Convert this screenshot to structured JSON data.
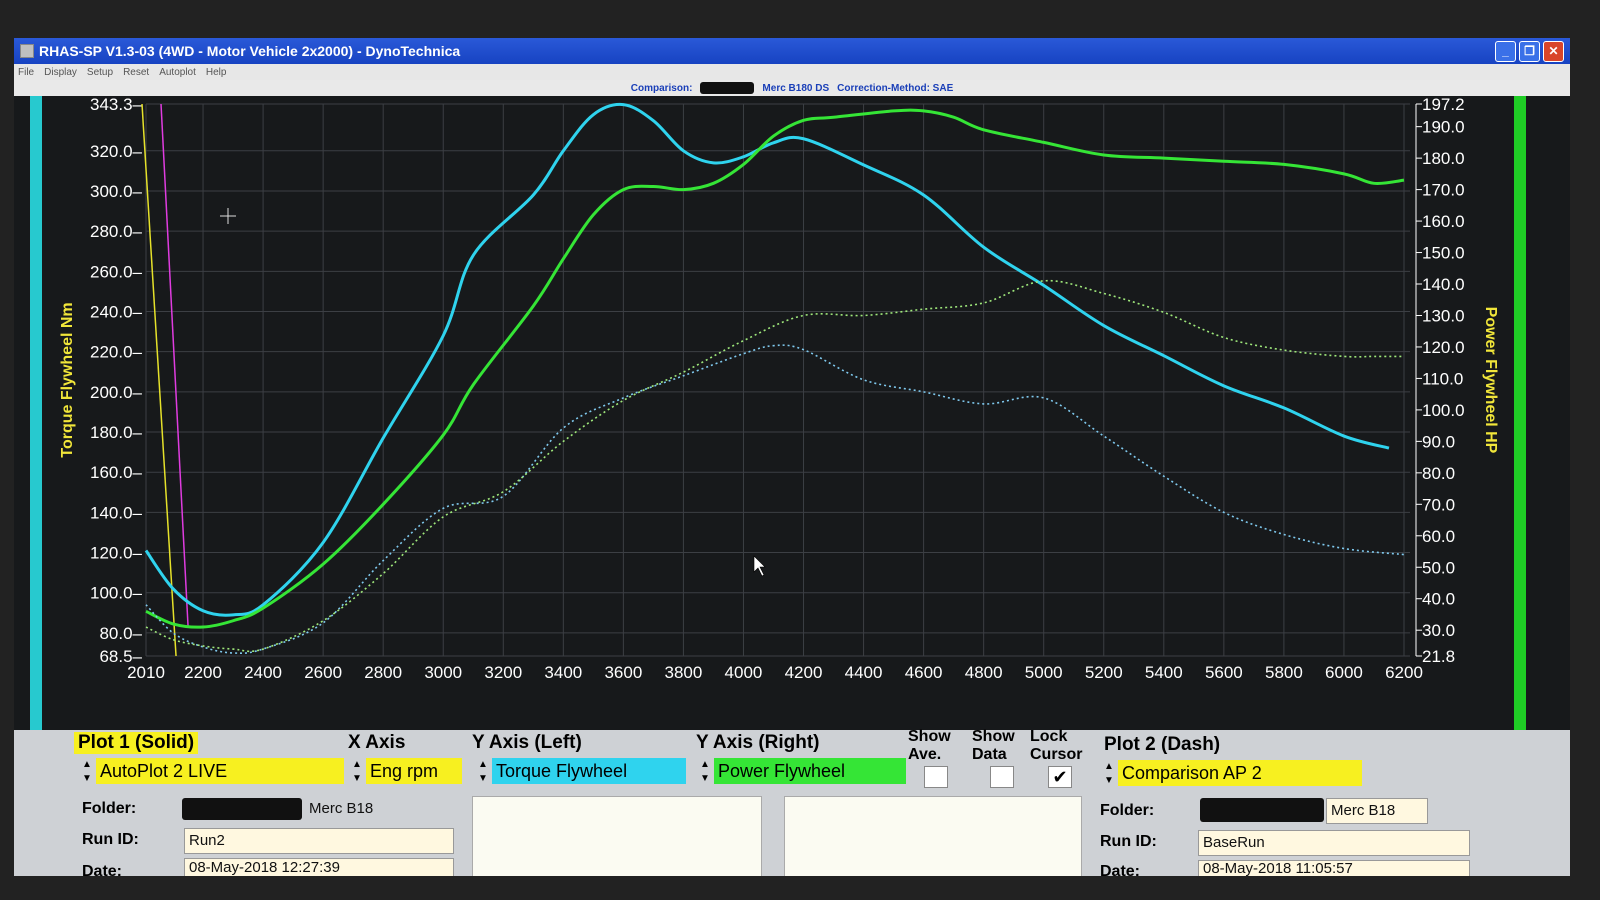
{
  "window": {
    "title": "RHAS-SP V1.3-03  (4WD - Motor Vehicle 2x2000) - DynoTechnica",
    "buttons": {
      "minimize": "_",
      "maximize": "❐",
      "close": "✕"
    }
  },
  "menu": [
    "File",
    "Display",
    "Setup",
    "Reset",
    "Autoplot",
    "Help"
  ],
  "comparison_bar": {
    "label": "Comparison:",
    "name": "Merc B180 DS",
    "correction": "Correction-Method: SAE"
  },
  "axes": {
    "left_title": "Torque Flywheel Nm",
    "right_title": "Power Flywheel HP",
    "left_ticks": [
      "343.3",
      "320.0",
      "300.0",
      "280.0",
      "260.0",
      "240.0",
      "220.0",
      "200.0",
      "180.0",
      "160.0",
      "140.0",
      "120.0",
      "100.0",
      "80.0",
      "68.5"
    ],
    "right_ticks": [
      "197.2",
      "190.0",
      "180.0",
      "170.0",
      "160.0",
      "150.0",
      "140.0",
      "130.0",
      "120.0",
      "110.0",
      "100.0",
      "90.0",
      "80.0",
      "70.0",
      "60.0",
      "50.0",
      "40.0",
      "30.0",
      "21.8"
    ],
    "x_ticks": [
      "2010",
      "2200",
      "2400",
      "2600",
      "2800",
      "3000",
      "3200",
      "3400",
      "3600",
      "3800",
      "4000",
      "4200",
      "4400",
      "4600",
      "4800",
      "5000",
      "5200",
      "5400",
      "5600",
      "5800",
      "6000",
      "6200"
    ]
  },
  "chart_data": {
    "type": "line",
    "x_range": [
      2010,
      6220
    ],
    "y_left_range": [
      68.5,
      343.3
    ],
    "y_right_range": [
      21.8,
      197.2
    ],
    "grid": true,
    "series": [
      {
        "name": "Torque Flywheel",
        "axis": "left",
        "style": "solid",
        "color": "#2fd3ee",
        "x": [
          2010,
          2100,
          2200,
          2300,
          2400,
          2600,
          2800,
          3000,
          3100,
          3300,
          3400,
          3500,
          3600,
          3700,
          3800,
          3900,
          4000,
          4100,
          4200,
          4400,
          4600,
          4800,
          5000,
          5200,
          5400,
          5600,
          5800,
          6000,
          6150
        ],
        "y": [
          121,
          102,
          91,
          89,
          94,
          125,
          177,
          228,
          268,
          298,
          320,
          338,
          343,
          335,
          320,
          314,
          317,
          324,
          326,
          313,
          298,
          272,
          253,
          233,
          218,
          203,
          192,
          178,
          172
        ]
      },
      {
        "name": "Power Flywheel",
        "axis": "right",
        "style": "solid",
        "color": "#35e536",
        "x": [
          2010,
          2100,
          2200,
          2300,
          2400,
          2600,
          2800,
          3000,
          3100,
          3300,
          3400,
          3500,
          3600,
          3700,
          3800,
          3900,
          4000,
          4100,
          4200,
          4300,
          4500,
          4600,
          4700,
          4800,
          5000,
          5200,
          5400,
          5600,
          5800,
          6000,
          6100,
          6200
        ],
        "y": [
          36,
          32,
          31,
          33,
          37,
          51,
          70,
          92,
          108,
          133,
          148,
          162,
          170,
          171,
          170,
          172,
          178,
          187,
          192,
          193,
          195,
          195,
          193,
          189,
          185,
          181,
          180,
          179,
          178,
          175,
          172,
          173
        ]
      },
      {
        "name": "Torque Flywheel (Comparison)",
        "axis": "left",
        "style": "dashed",
        "color": "#7fc9ee",
        "x": [
          2010,
          2100,
          2200,
          2300,
          2400,
          2600,
          2800,
          3000,
          3200,
          3400,
          3600,
          3800,
          4000,
          4100,
          4200,
          4400,
          4600,
          4800,
          5000,
          5200,
          5400,
          5600,
          5800,
          6000,
          6200
        ],
        "y": [
          94,
          80,
          73,
          70,
          72,
          85,
          116,
          142,
          148,
          182,
          197,
          208,
          219,
          223,
          221,
          206,
          200,
          194,
          197,
          178,
          158,
          140,
          129,
          122,
          119
        ]
      },
      {
        "name": "Power Flywheel (Comparison)",
        "axis": "right",
        "style": "dashed",
        "color": "#9fe87b",
        "x": [
          2010,
          2100,
          2200,
          2300,
          2400,
          2600,
          2800,
          3000,
          3200,
          3400,
          3600,
          3800,
          4000,
          4200,
          4400,
          4600,
          4800,
          5000,
          5200,
          5400,
          5600,
          5800,
          6000,
          6100,
          6200
        ],
        "y": [
          31,
          27,
          25,
          24,
          24,
          33,
          48,
          66,
          74,
          90,
          103,
          112,
          122,
          130,
          130,
          132,
          134,
          141,
          137,
          131,
          123,
          119,
          117,
          117,
          117
        ]
      }
    ]
  },
  "plot1": {
    "heading": "Plot 1 (Solid)",
    "source": "AutoPlot 2 LIVE",
    "folder_label": "Folder:",
    "folder_value": "Merc B18",
    "runid_label": "Run ID:",
    "runid_value": "Run2",
    "date_label": "Date:",
    "date_value": "08-May-2018   12:27:39"
  },
  "xaxis_sel": {
    "heading": "X Axis",
    "value": "Eng rpm"
  },
  "yleft_sel": {
    "heading": "Y Axis (Left)",
    "value": "Torque Flywheel"
  },
  "yright_sel": {
    "heading": "Y Axis (Right)",
    "value": "Power Flywheel"
  },
  "checks": {
    "show_ave_1": "Show",
    "show_ave_2": "Ave.",
    "show_data_1": "Show",
    "show_data_2": "Data",
    "lock_cursor_1": "Lock",
    "lock_cursor_2": "Cursor",
    "lock_cursor_checked": "✔"
  },
  "plot2": {
    "heading": "Plot 2 (Dash)",
    "source": "Comparison AP 2",
    "folder_label": "Folder:",
    "folder_value": "Merc B18",
    "runid_label": "Run ID:",
    "runid_value": "BaseRun",
    "date_label": "Date:",
    "date_value": "08-May-2018   11:05:57"
  },
  "colors": {
    "torque": "#2fd3ee",
    "power": "#35e536",
    "plot1_highlight": "#f7f020",
    "left_axis_title": "#f1e63a",
    "cursor_yellow": "#e6e22a",
    "cursor_magenta": "#e03ce0"
  }
}
